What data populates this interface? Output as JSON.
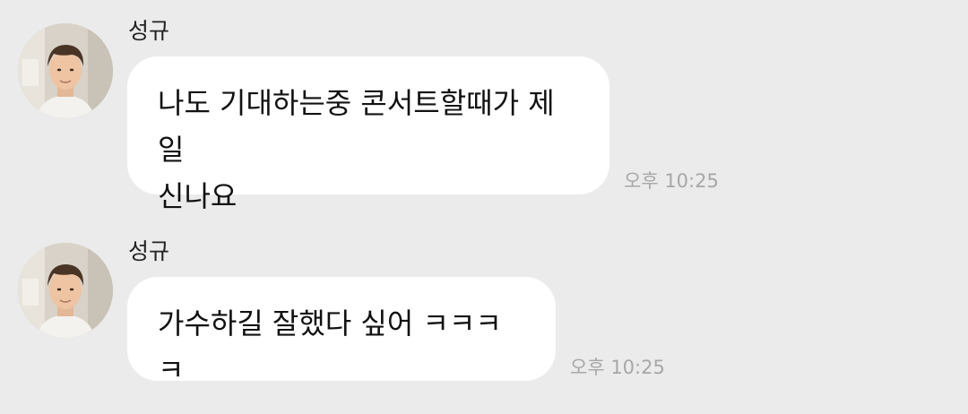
{
  "messages": [
    {
      "sender": "성규",
      "text": "나도 기대하는중 콘서트할때가 제일\n신나요",
      "time": "오후 10:25"
    },
    {
      "sender": "성규",
      "text": "가수하길 잘했다 싶어 ㅋㅋㅋㅋ",
      "time": "오후 10:25"
    }
  ],
  "colors": {
    "background": "#ebebeb",
    "bubble": "#ffffff",
    "time": "#a7a7a7"
  }
}
